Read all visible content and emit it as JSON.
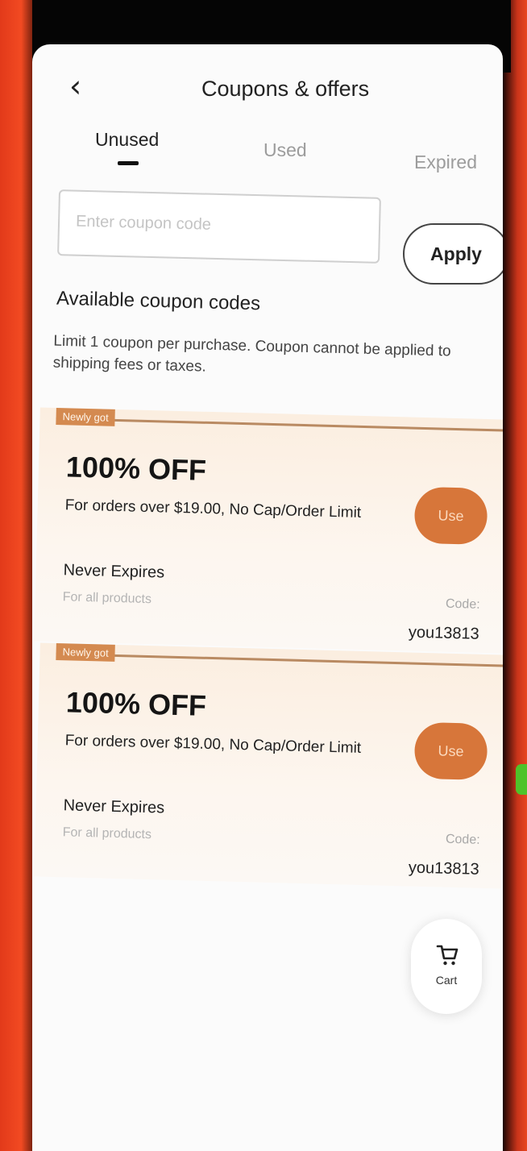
{
  "header": {
    "title": "Coupons & offers",
    "back_icon": "chevron-left-icon"
  },
  "tabs": [
    {
      "label": "Unused",
      "active": true
    },
    {
      "label": "Used",
      "active": false
    },
    {
      "label": "Expired",
      "active": false
    }
  ],
  "coupon_entry": {
    "placeholder": "Enter coupon code",
    "value": "",
    "apply_label": "Apply"
  },
  "available": {
    "heading": "Available coupon codes",
    "note": "Limit 1 coupon per purchase. Coupon cannot be applied to shipping fees or taxes."
  },
  "coupons": [
    {
      "badge": "Newly got",
      "discount": "100% OFF",
      "condition": "For orders over $19.00, No Cap/Order Limit",
      "use_label": "Use",
      "expiry": "Never Expires",
      "scope": "For all products",
      "code_label": "Code:",
      "code": "you13813"
    },
    {
      "badge": "Newly got",
      "discount": "100% OFF",
      "condition": "For orders over $19.00, No Cap/Order Limit",
      "use_label": "Use",
      "expiry": "Never Expires",
      "scope": "For all products",
      "code_label": "Code:",
      "code": "you13813"
    }
  ],
  "cart": {
    "label": "Cart",
    "icon": "cart-icon"
  },
  "colors": {
    "accent": "#d7763a",
    "badge": "#d48a50",
    "device_frame": "#e8461f"
  }
}
